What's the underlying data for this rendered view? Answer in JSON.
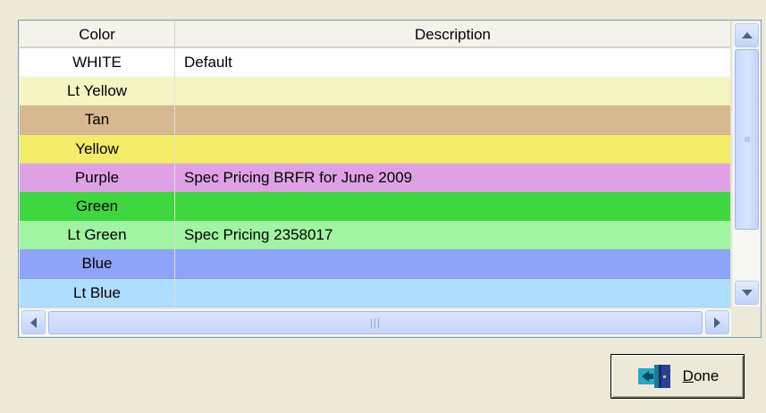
{
  "grid": {
    "columns": [
      "Color",
      "Description"
    ],
    "rows": [
      {
        "color": "WHITE",
        "description": "Default",
        "bg": "#ffffff"
      },
      {
        "color": "Lt Yellow",
        "description": "",
        "bg": "#f5f5c3"
      },
      {
        "color": "Tan",
        "description": "",
        "bg": "#d7b991"
      },
      {
        "color": "Yellow",
        "description": "",
        "bg": "#f2ec68"
      },
      {
        "color": "Purple",
        "description": "Spec Pricing BRFR for June 2009",
        "bg": "#dea2e4"
      },
      {
        "color": "Green",
        "description": "",
        "bg": "#3ed73f"
      },
      {
        "color": "Lt Green",
        "description": "Spec Pricing 2358017",
        "bg": "#a1f4a2"
      },
      {
        "color": "Blue",
        "description": "",
        "bg": "#8ea4f9"
      },
      {
        "color": "Lt Blue",
        "description": "",
        "bg": "#aeddfd"
      }
    ]
  },
  "icons": {
    "scroll_up": "chevron-up-icon",
    "scroll_down": "chevron-down-icon",
    "scroll_left": "chevron-left-icon",
    "scroll_right": "chevron-right-icon",
    "done": "exit-door-icon"
  },
  "done_button": {
    "mnemonic": "D",
    "label_rest": "one"
  }
}
